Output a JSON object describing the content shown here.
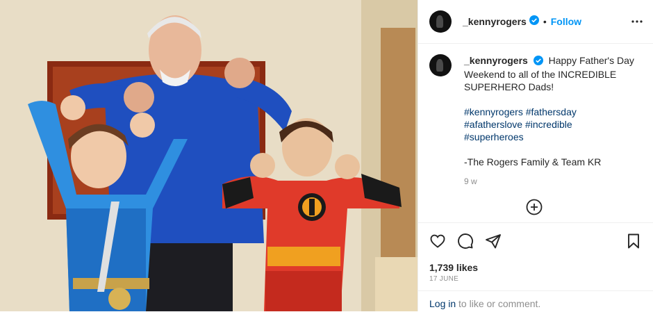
{
  "post": {
    "username": "_kennyrogers",
    "follow_label": "Follow",
    "dot": "•"
  },
  "caption": {
    "username": "_kennyrogers",
    "text": "Happy Father's Day Weekend to all of the INCREDIBLE SUPERHERO Dads!",
    "hashtags_line1": [
      "#kennyrogers",
      "#fathersday"
    ],
    "hashtags_line2": [
      "#afatherslove",
      "#incredible"
    ],
    "hashtags_line3": [
      "#superheroes"
    ],
    "signoff": "-The Rogers Family & Team KR",
    "time_ago": "9 w"
  },
  "stats": {
    "likes": "1,739 likes",
    "date": "17 JUNE"
  },
  "footer": {
    "login_link": "Log in",
    "rest": " to like or comment."
  },
  "icons": {
    "verified": "verified-badge-icon",
    "more": "more-options-icon",
    "add_comment": "add-comment-icon",
    "like": "heart-icon",
    "comment": "comment-bubble-icon",
    "share": "share-paper-plane-icon",
    "save": "bookmark-icon"
  },
  "colors": {
    "accent": "#0095f6",
    "hashtag": "#00376b",
    "secondary_text": "#8e8e8e",
    "divider": "#efefef"
  }
}
